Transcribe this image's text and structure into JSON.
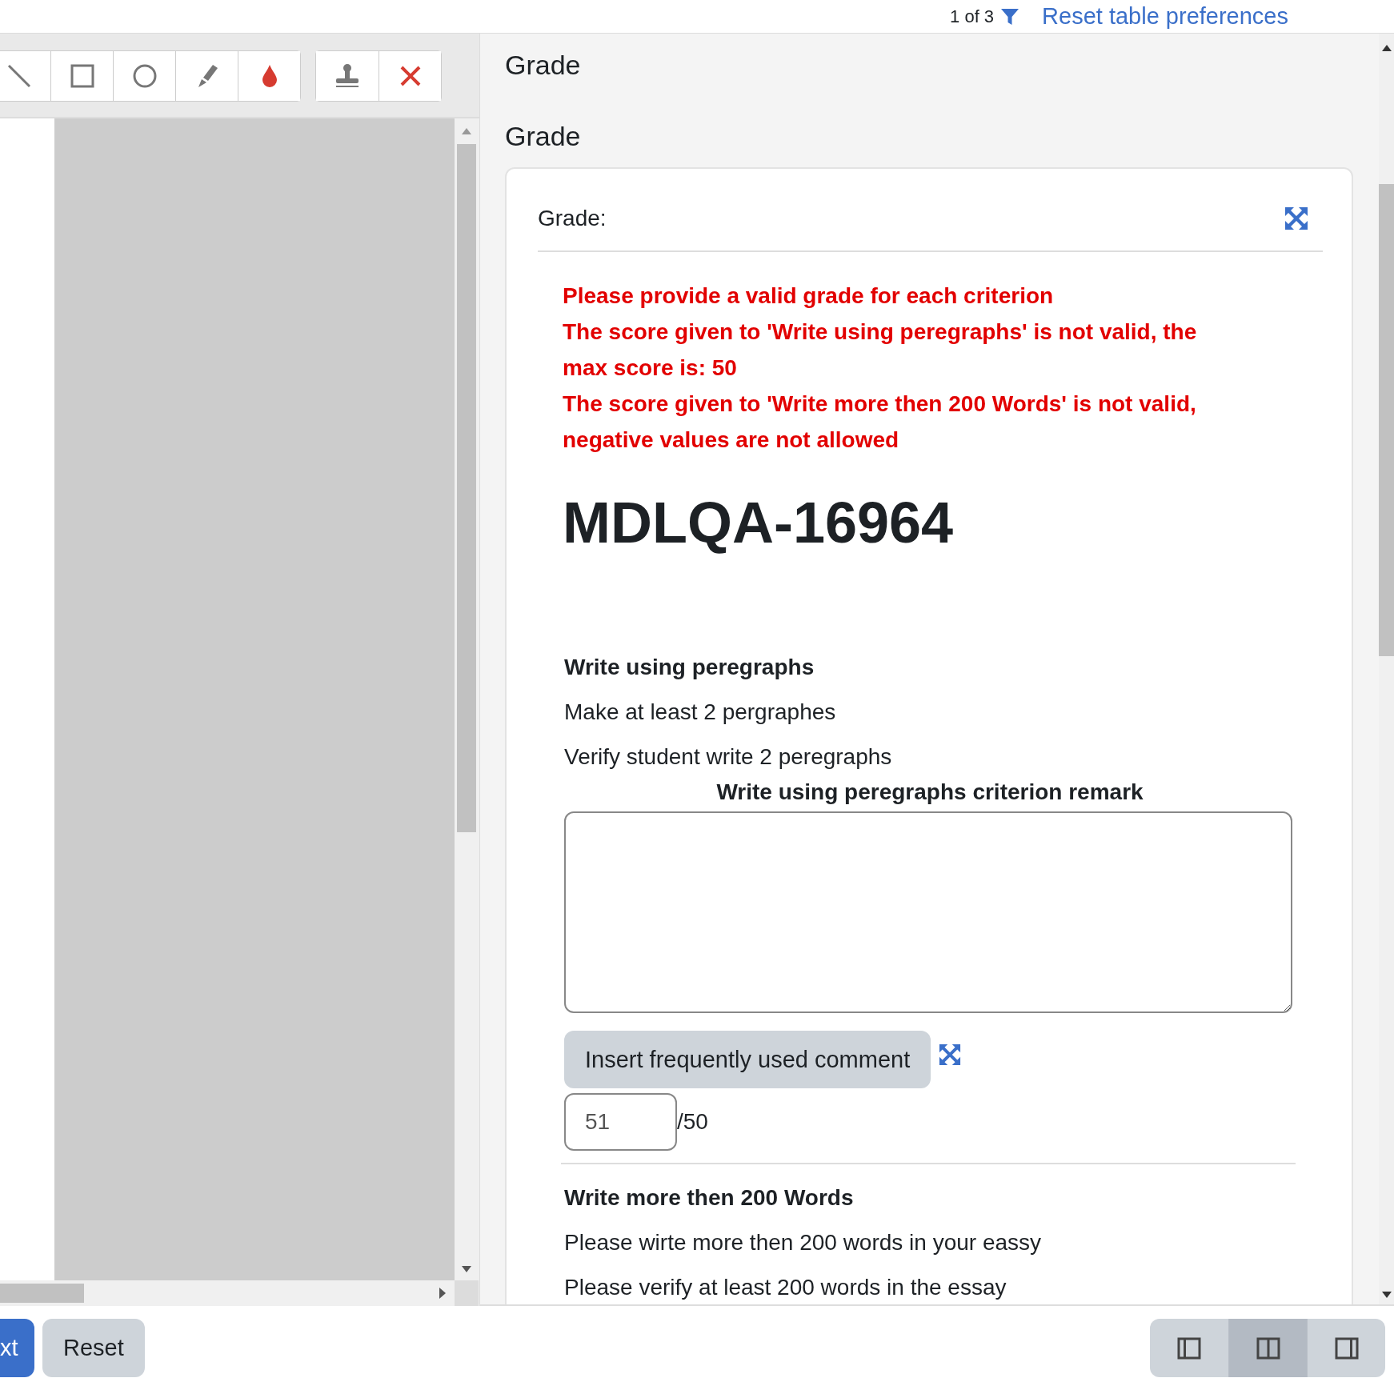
{
  "top_bar": {
    "pager": "1 of 3",
    "reset_link": "Reset table preferences"
  },
  "right_panel": {
    "headings": [
      "Grade",
      "Grade"
    ],
    "card": {
      "label": "Grade:",
      "errors": [
        "Please provide a valid grade for each criterion",
        "The score given to 'Write using peregraphs' is not valid, the max score is: 50",
        "The score given to 'Write more then 200 Words' is not valid, negative values are not allowed"
      ],
      "title": "MDLQA-16964",
      "criteria": [
        {
          "title": "Write using peregraphs",
          "descriptions": [
            "Make at least 2 pergraphes",
            "Verify student write 2 peregraphs"
          ],
          "remark_label": "Write using peregraphs criterion remark",
          "comment_button": "Insert frequently used comment",
          "score": "51",
          "max_score": "/50"
        },
        {
          "title": "Write more then 200 Words",
          "descriptions": [
            "Please wirte more then 200 words in your eassy",
            "Please verify at least 200 words in the essay"
          ]
        }
      ]
    }
  },
  "bottom_bar": {
    "next_button": "xt",
    "reset_button": "Reset",
    "layout_buttons": [
      {
        "kind": "left",
        "selected": false
      },
      {
        "kind": "split",
        "selected": true
      },
      {
        "kind": "right",
        "selected": false
      }
    ]
  }
}
